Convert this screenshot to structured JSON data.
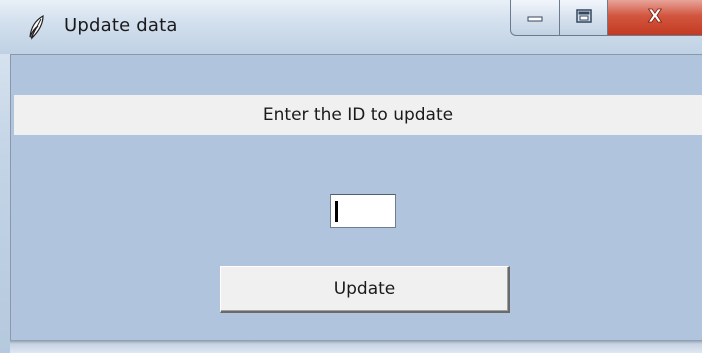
{
  "window": {
    "title": "Update data",
    "app_icon": "feather-icon",
    "caption_buttons": {
      "minimize_icon": "minimize-icon",
      "maximize_icon": "maximize-icon",
      "close_icon": "close-icon",
      "close_glyph": "X"
    }
  },
  "form": {
    "prompt_label": "Enter the ID to update",
    "id_input": {
      "value": "",
      "placeholder": ""
    },
    "update_button_label": "Update"
  },
  "colors": {
    "client_background": "#b0c4de",
    "label_band": "#f0f0f0",
    "close_button": "#c43a22"
  }
}
